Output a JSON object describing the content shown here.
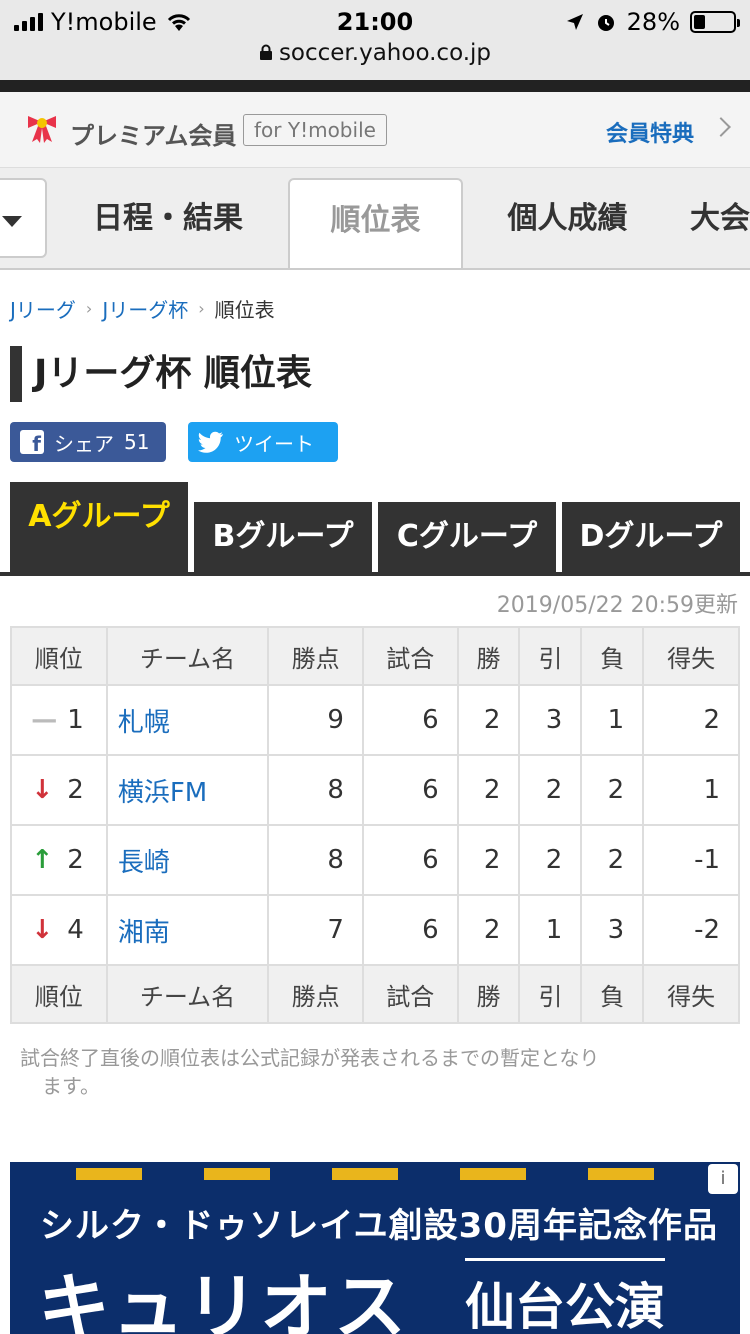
{
  "status": {
    "carrier": "Y!mobile",
    "time": "21:00",
    "battery": "28%",
    "battery_level": 0.28,
    "url": "soccer.yahoo.co.jp"
  },
  "premium": {
    "label": "プレミアム会員",
    "for_label": "for Y!mobile",
    "perks_link": "会員特典"
  },
  "nav": {
    "tabs": [
      "日程・結果",
      "順位表",
      "個人成績",
      "大会"
    ],
    "active_tab": "順位表"
  },
  "breadcrumb": [
    "Jリーグ",
    "Jリーグ杯",
    "順位表"
  ],
  "page_title": "Jリーグ杯 順位表",
  "share": {
    "facebook_label": "シェア",
    "facebook_count": "51",
    "tweet_label": "ツイート"
  },
  "groups": {
    "tabs": [
      "Aグループ",
      "Bグループ",
      "Cグループ",
      "Dグループ"
    ],
    "active": "Aグループ"
  },
  "updated": "2019/05/22 20:59更新",
  "table": {
    "headers": [
      "順位",
      "チーム名",
      "勝点",
      "試合",
      "勝",
      "引",
      "負",
      "得失"
    ],
    "rows": [
      {
        "trend": "same",
        "trend_icon": "—",
        "rank": "1",
        "team": "札幌",
        "points": "9",
        "played": "6",
        "win": "2",
        "draw": "3",
        "loss": "1",
        "diff": "2"
      },
      {
        "trend": "down",
        "trend_icon": "↓",
        "rank": "2",
        "team": "横浜FM",
        "points": "8",
        "played": "6",
        "win": "2",
        "draw": "2",
        "loss": "2",
        "diff": "1"
      },
      {
        "trend": "up",
        "trend_icon": "↑",
        "rank": "2",
        "team": "長崎",
        "points": "8",
        "played": "6",
        "win": "2",
        "draw": "2",
        "loss": "2",
        "diff": "-1"
      },
      {
        "trend": "down",
        "trend_icon": "↓",
        "rank": "4",
        "team": "湘南",
        "points": "7",
        "played": "6",
        "win": "2",
        "draw": "1",
        "loss": "3",
        "diff": "-2"
      }
    ]
  },
  "note_line1": "試合終了直後の順位表は公式記録が発表されるまでの暫定となり",
  "note_line2": "ます。",
  "ad": {
    "line1": "シルク・ドゥソレイユ創設30周年記念作品",
    "line2": "キュリオス",
    "line3": "仙台公演"
  },
  "colors": {
    "link": "#1a6dbd",
    "active_group": "#ffe000",
    "trend_down": "#d0323a",
    "trend_up": "#2a9d3a"
  }
}
